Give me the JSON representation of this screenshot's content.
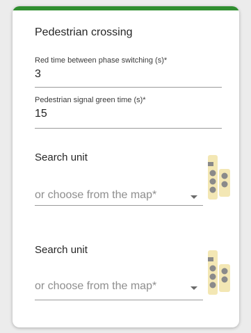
{
  "panel": {
    "title": "Pedestrian crossing",
    "fields": [
      {
        "label": "Red time between phase switching (s)*",
        "value": "3"
      },
      {
        "label": "Pedestrian signal green time (s)*",
        "value": "15"
      }
    ],
    "units": [
      {
        "heading": "Search unit",
        "placeholder": "or choose from the map*",
        "icon": "traffic-light-icon"
      },
      {
        "heading": "Search unit",
        "placeholder": "or choose from the map*",
        "icon": "traffic-light-icon"
      }
    ]
  },
  "colors": {
    "accent": "#2f8e2f",
    "icon_fill": "#f3e7b4",
    "icon_lamp": "#8a8a8a"
  }
}
